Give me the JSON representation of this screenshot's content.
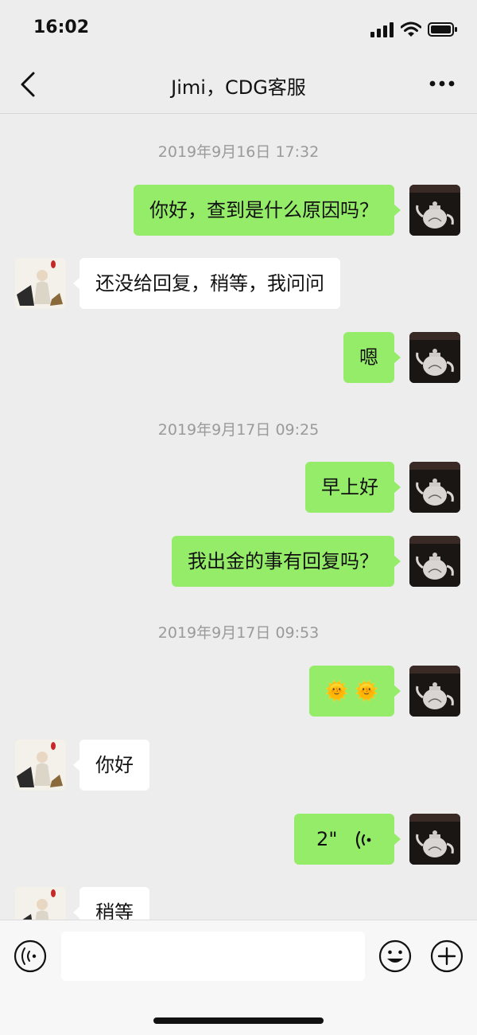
{
  "status": {
    "time": "16:02"
  },
  "nav": {
    "title": "Jimi，CDG客服"
  },
  "chat": {
    "timestamps": [
      "2019年9月16日 17:32",
      "2019年9月17日 09:25",
      "2019年9月17日 09:53"
    ],
    "messages": [
      {
        "side": "right",
        "text": "你好，查到是什么原因吗？"
      },
      {
        "side": "left",
        "text": "还没给回复，稍等，我问问"
      },
      {
        "side": "right",
        "text": "嗯"
      },
      {
        "side": "right",
        "text": "早上好"
      },
      {
        "side": "right",
        "text": "我出金的事有回复吗？"
      },
      {
        "side": "right",
        "text": "🌞 🌞"
      },
      {
        "side": "left",
        "text": "你好"
      },
      {
        "side": "right",
        "text": "2\""
      },
      {
        "side": "left",
        "text": "稍等"
      }
    ]
  },
  "colors": {
    "sent_bubble": "#95ec69",
    "received_bubble": "#ffffff",
    "background": "#ededed"
  }
}
